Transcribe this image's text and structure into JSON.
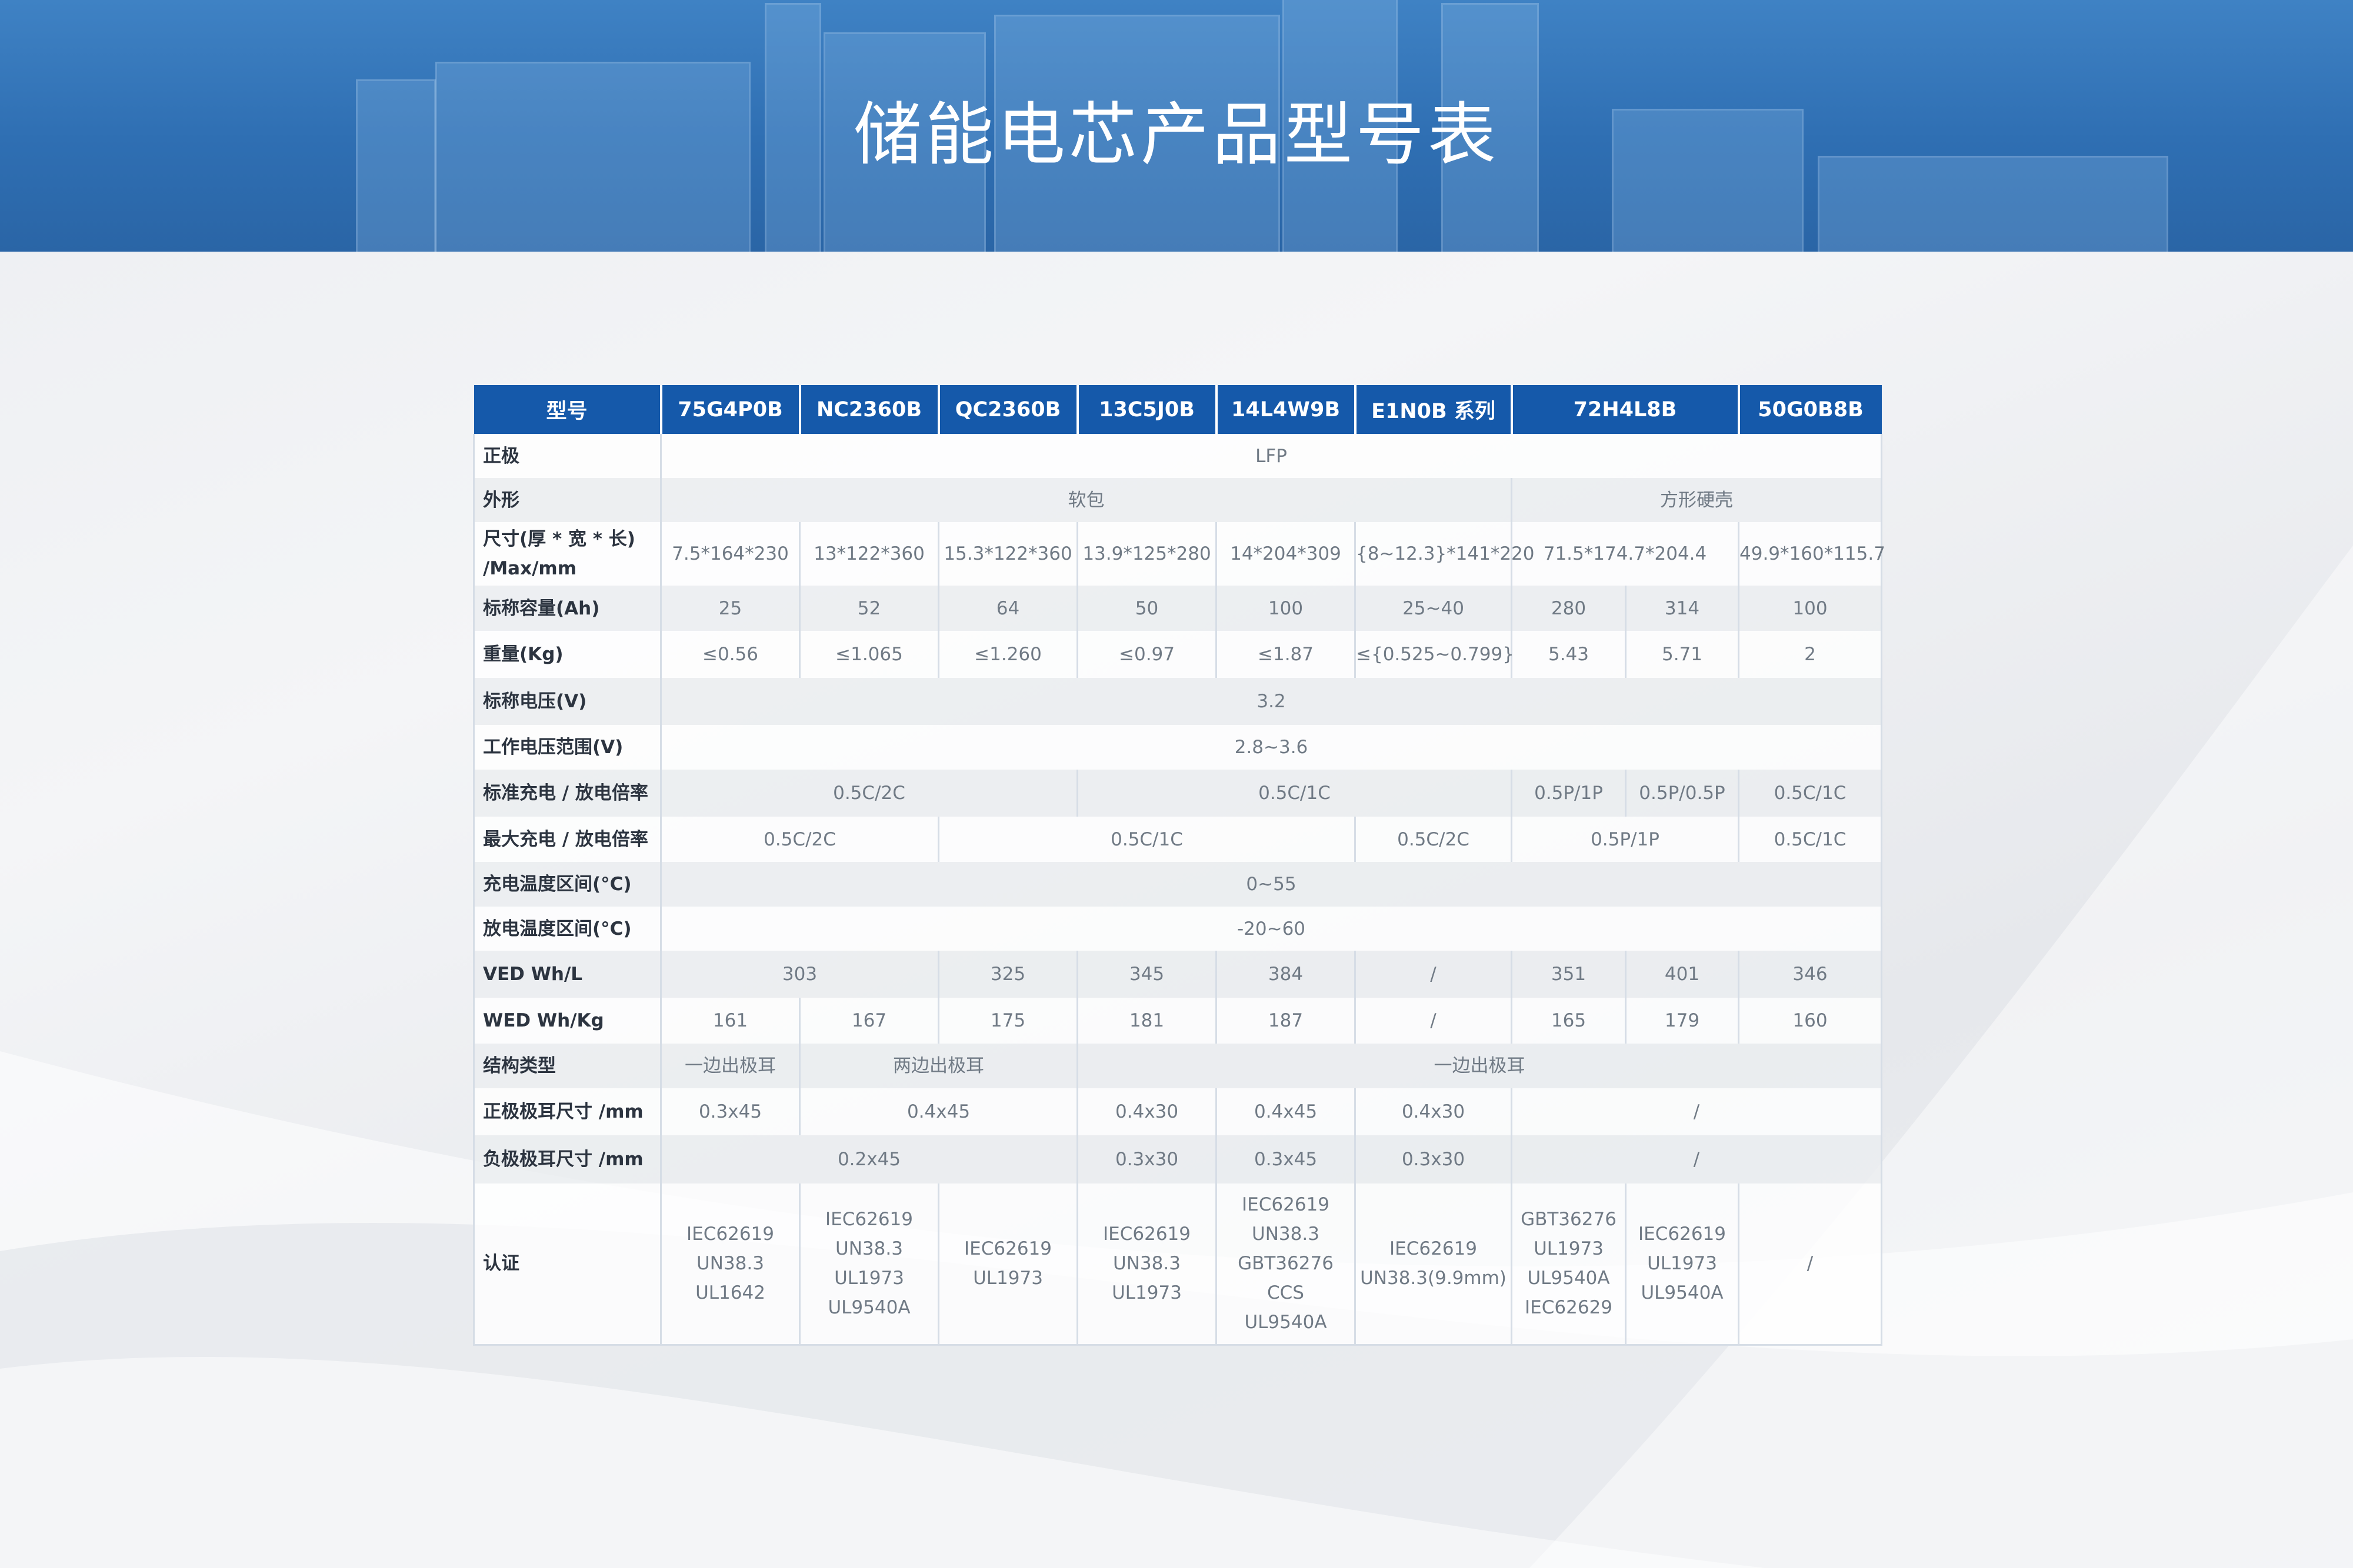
{
  "banner": {
    "title": "储能电芯产品型号表"
  },
  "table": {
    "header": {
      "label": "型号",
      "models": [
        "75G4P0B",
        "NC2360B",
        "QC2360B",
        "13C5J0B",
        "14L4W9B",
        "E1N0B 系列",
        "72H4L8B",
        "50G0B8B"
      ]
    },
    "positive": {
      "label": "正极",
      "value": "LFP"
    },
    "shape": {
      "label": "外形",
      "pouch": "软包",
      "prismatic": "方形硬壳"
    },
    "size": {
      "label_line1": "尺寸(厚 * 宽 * 长)",
      "label_line2": "/Max/mm",
      "values": [
        "7.5*164*230",
        "13*122*360",
        "15.3*122*360",
        "13.9*125*280",
        "14*204*309",
        "{8~12.3}*141*220",
        "71.5*174.7*204.4",
        "49.9*160*115.7"
      ]
    },
    "capacity": {
      "label": "标称容量(Ah)",
      "values": [
        "25",
        "52",
        "64",
        "50",
        "100",
        "25~40",
        "280",
        "314",
        "100"
      ]
    },
    "weight": {
      "label": "重量(Kg)",
      "values": [
        "≤0.56",
        "≤1.065",
        "≤1.260",
        "≤0.97",
        "≤1.87",
        "≤{0.525~0.799}",
        "5.43",
        "5.71",
        "2"
      ]
    },
    "voltage": {
      "label": "标称电压(V)",
      "value": "3.2"
    },
    "voltage_range": {
      "label": "工作电压范围(V)",
      "value": "2.8~3.6"
    },
    "std_rate": {
      "label": "标准充电 / 放电倍率",
      "values": [
        "0.5C/2C",
        "0.5C/1C",
        "0.5P/1P",
        "0.5P/0.5P",
        "0.5C/1C"
      ]
    },
    "max_rate": {
      "label": "最大充电 / 放电倍率",
      "values": [
        "0.5C/2C",
        "0.5C/1C",
        "0.5C/2C",
        "0.5P/1P",
        "0.5C/1C"
      ]
    },
    "charge_temp": {
      "label": "充电温度区间(°C)",
      "value": "0~55"
    },
    "discharge_temp": {
      "label": "放电温度区间(°C)",
      "value": "-20~60"
    },
    "ved": {
      "label": "VED Wh/L",
      "values": [
        "303",
        "325",
        "345",
        "384",
        "/",
        "351",
        "401",
        "346"
      ]
    },
    "wed": {
      "label": "WED Wh/Kg",
      "values": [
        "161",
        "167",
        "175",
        "181",
        "187",
        "/",
        "165",
        "179",
        "160"
      ]
    },
    "structure": {
      "label": "结构类型",
      "values": [
        "一边出极耳",
        "两边出极耳",
        "一边出极耳"
      ]
    },
    "pos_tab": {
      "label": "正极极耳尺寸 /mm",
      "values": [
        "0.3x45",
        "0.4x45",
        "0.4x30",
        "0.4x45",
        "0.4x30",
        "/"
      ]
    },
    "neg_tab": {
      "label": "负极极耳尺寸 /mm",
      "values": [
        "0.2x45",
        "0.3x30",
        "0.3x45",
        "0.3x30",
        "/"
      ]
    },
    "cert": {
      "label": "认证",
      "c1": [
        "IEC62619",
        "UN38.3",
        "UL1642"
      ],
      "c2": [
        "IEC62619",
        "UN38.3",
        "UL1973",
        "UL9540A"
      ],
      "c3": [
        "IEC62619",
        "UL1973"
      ],
      "c4": [
        "IEC62619",
        "UN38.3",
        "UL1973"
      ],
      "c5": [
        "IEC62619",
        "UN38.3",
        "GBT36276",
        "CCS",
        "UL9540A"
      ],
      "c6": [
        "IEC62619",
        "UN38.3(9.9mm)"
      ],
      "c7": [
        "GBT36276",
        "UL1973",
        "UL9540A",
        "IEC62629"
      ],
      "c8": [
        "IEC62619",
        "UL1973",
        "UL9540A"
      ],
      "c9": [
        "/"
      ]
    }
  }
}
